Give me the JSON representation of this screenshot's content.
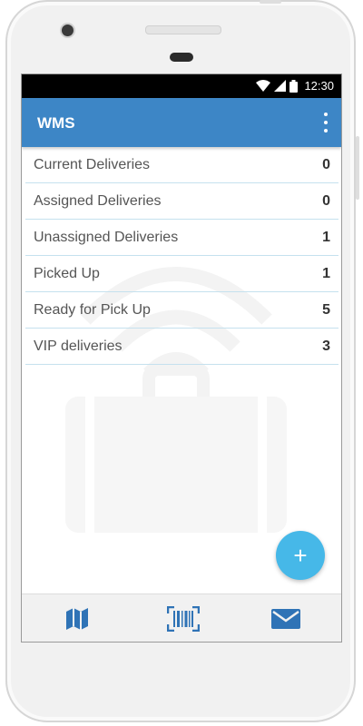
{
  "status_bar": {
    "time": "12:30"
  },
  "app_bar": {
    "title": "WMS"
  },
  "deliveries": [
    {
      "label": "Current Deliveries",
      "count": "0"
    },
    {
      "label": "Assigned Deliveries",
      "count": "0"
    },
    {
      "label": "Unassigned Deliveries",
      "count": "1"
    },
    {
      "label": "Picked Up",
      "count": "1"
    },
    {
      "label": "Ready for Pick Up",
      "count": "5"
    },
    {
      "label": "VIP deliveries",
      "count": "3"
    }
  ],
  "fab": {
    "icon": "plus-icon",
    "label": "+"
  },
  "bottom_nav": [
    {
      "icon": "map-icon"
    },
    {
      "icon": "barcode-scan-icon"
    },
    {
      "icon": "mail-icon"
    }
  ],
  "colors": {
    "app_bar": "#3d86c6",
    "fab": "#46b8e8",
    "nav_icon": "#2f73b6",
    "divider": "#c5e1ee"
  }
}
